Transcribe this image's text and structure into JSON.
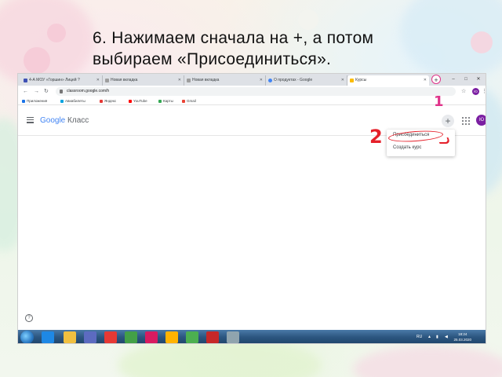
{
  "instruction": {
    "line1": "6. Нажимаем сначала на +, а потом",
    "line2": "выбираем «Присоединиться»."
  },
  "browser": {
    "tabs": [
      {
        "label": "4-А МОУ «Горшин» Лицей ?",
        "icon": "account-box-icon",
        "color": "#3f51b5"
      },
      {
        "label": "Новая вкладка",
        "icon": "blank-page-icon",
        "color": "#9e9e9e"
      },
      {
        "label": "Новая вкладка",
        "icon": "blank-page-icon",
        "color": "#9e9e9e"
      },
      {
        "label": "О продуктах - Google",
        "icon": "google-icon",
        "color": "#4285f4"
      },
      {
        "label": "Курсы",
        "icon": "classroom-icon",
        "color": "#fbbc04",
        "active": true
      }
    ],
    "new_tab_symbol": "+",
    "url": "classroom.google.com/h",
    "avatar_letter": "Ю",
    "bookmarks": [
      {
        "label": "Приложения",
        "color": "#1a73e8"
      },
      {
        "label": "Авиабилеты",
        "color": "#00a3e0"
      },
      {
        "label": "Яндекс",
        "color": "#e53935"
      },
      {
        "label": "YouTube",
        "color": "#ff0000"
      },
      {
        "label": "Карты",
        "color": "#34a853"
      },
      {
        "label": "Gmail",
        "color": "#ea4335"
      }
    ]
  },
  "classroom": {
    "logo_google": "Google",
    "logo_product": "Класс",
    "plus_symbol": "+",
    "avatar_letter": "Ю",
    "menu": {
      "join": "Присоединиться",
      "create": "Создать курс"
    },
    "help_symbol": "?"
  },
  "annotations": {
    "step1": "1",
    "step2": "2",
    "colors": {
      "step1": "#e0338a",
      "step2": "#e5202a"
    }
  },
  "taskbar": {
    "lang": "RU",
    "time": "18:24",
    "date": "25.03.2020"
  }
}
